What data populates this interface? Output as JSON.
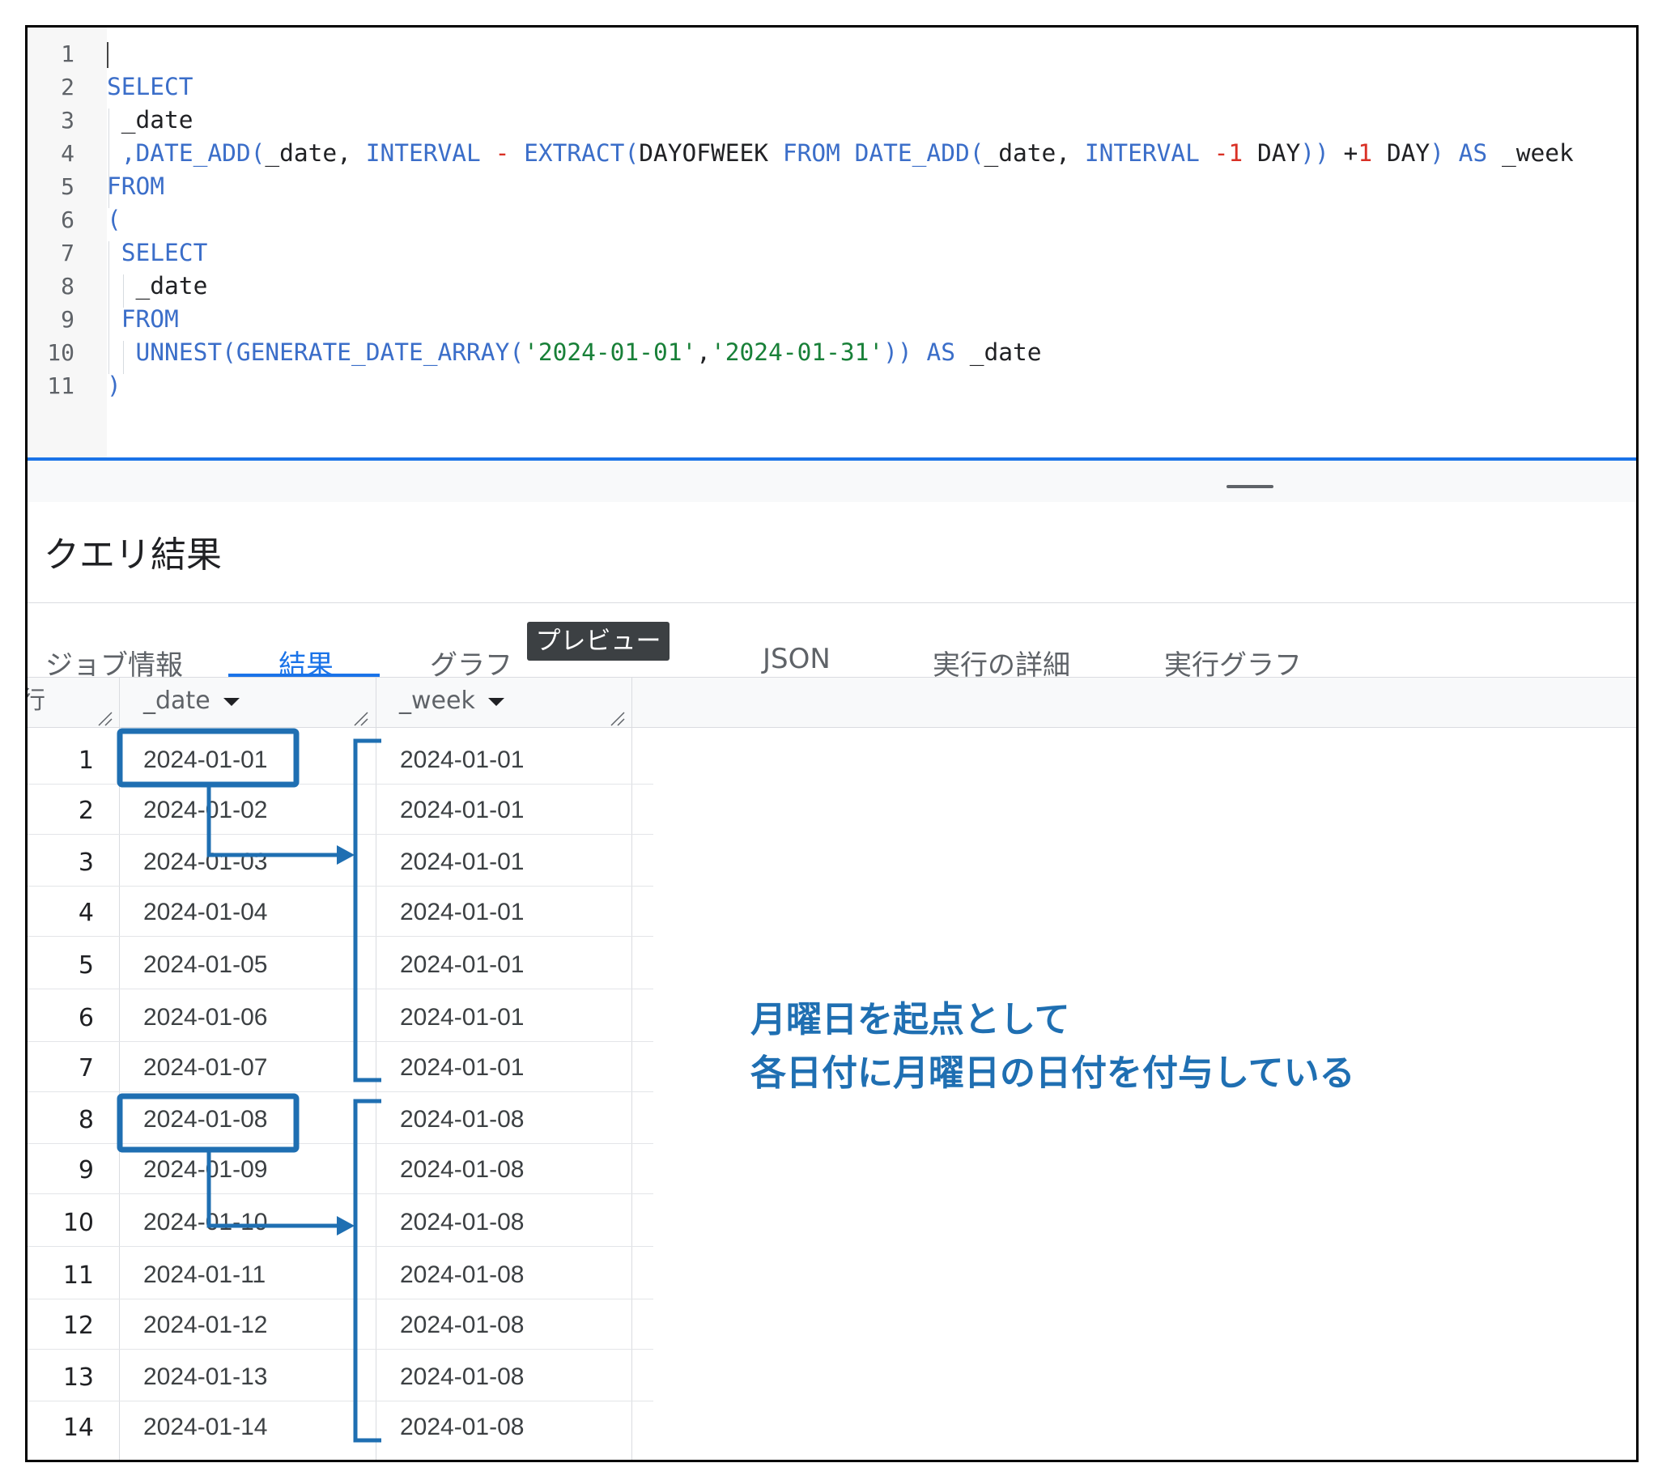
{
  "editor": {
    "line_numbers": [
      "1",
      "2",
      "3",
      "4",
      "5",
      "6",
      "7",
      "8",
      "9",
      "10",
      "11"
    ]
  },
  "results": {
    "title": "クエリ結果",
    "tabs": [
      {
        "label": "ジョブ情報"
      },
      {
        "label": "結果"
      },
      {
        "label": "グラフ"
      },
      {
        "label": "JSON"
      },
      {
        "label": "実行の詳細"
      },
      {
        "label": "実行グラフ"
      }
    ],
    "preview_badge": "プレビュー",
    "columns": {
      "row": "行",
      "date": "_date",
      "week": "_week"
    },
    "rows": [
      {
        "n": "1",
        "date": "2024-01-01",
        "week": "2024-01-01"
      },
      {
        "n": "2",
        "date": "2024-01-02",
        "week": "2024-01-01"
      },
      {
        "n": "3",
        "date": "2024-01-03",
        "week": "2024-01-01"
      },
      {
        "n": "4",
        "date": "2024-01-04",
        "week": "2024-01-01"
      },
      {
        "n": "5",
        "date": "2024-01-05",
        "week": "2024-01-01"
      },
      {
        "n": "6",
        "date": "2024-01-06",
        "week": "2024-01-01"
      },
      {
        "n": "7",
        "date": "2024-01-07",
        "week": "2024-01-01"
      },
      {
        "n": "8",
        "date": "2024-01-08",
        "week": "2024-01-08"
      },
      {
        "n": "9",
        "date": "2024-01-09",
        "week": "2024-01-08"
      },
      {
        "n": "10",
        "date": "2024-01-10",
        "week": "2024-01-08"
      },
      {
        "n": "11",
        "date": "2024-01-11",
        "week": "2024-01-08"
      },
      {
        "n": "12",
        "date": "2024-01-12",
        "week": "2024-01-08"
      },
      {
        "n": "13",
        "date": "2024-01-13",
        "week": "2024-01-08"
      },
      {
        "n": "14",
        "date": "2024-01-14",
        "week": "2024-01-08"
      }
    ]
  },
  "annotation": {
    "line1": "月曜日を起点として",
    "line2": "各日付に月曜日の日付を付与している",
    "color": "#1f6fb2"
  }
}
